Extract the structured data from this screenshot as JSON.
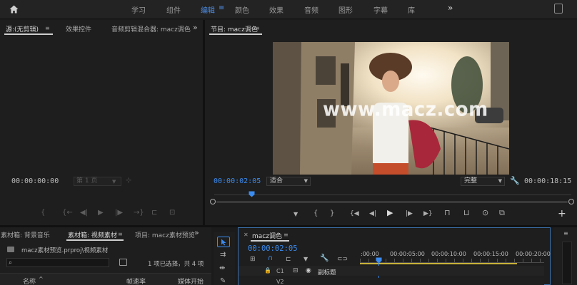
{
  "workspaces": {
    "home_icon": "home-icon",
    "tabs": [
      "学习",
      "组件",
      "编辑",
      "颜色",
      "效果",
      "音频",
      "图形",
      "字幕",
      "库"
    ],
    "active": "编辑",
    "more": "»"
  },
  "source_panel": {
    "tabs": [
      "源:(无剪辑)",
      "效果控件",
      "音频剪辑混合器: macz调色"
    ],
    "more": "»",
    "timecode": "00:00:00:00",
    "page_field": "第 1 页"
  },
  "program_panel": {
    "title": "节目: macz调色",
    "menu": "≡",
    "timecode": "00:00:02:05",
    "fit_label": "适合",
    "quality_label": "完整",
    "duration": "00:00:18:15",
    "watermark": "www.macz.com"
  },
  "project_panel": {
    "tabs": [
      "素材箱: 背景音乐",
      "素材箱: 视频素材",
      "项目: macz素材预览"
    ],
    "more": "»",
    "path": "macz素材预览.prproj\\视频素材",
    "selection_info": "1 项已选择，共 4 项",
    "columns": [
      "名称",
      "帧速率",
      "媒体开始"
    ]
  },
  "timeline_panel": {
    "title": "macz调色",
    "timecode": "00:00:02:05",
    "ruler": [
      ":00:00",
      "00:00:05:00",
      "00:00:10:00",
      "00:00:15:00",
      "00:00:20:00"
    ],
    "tracks": [
      {
        "lock": "🔒",
        "name": "C1",
        "label": "副标题"
      },
      {
        "lock": "",
        "name": "V2",
        "label": ""
      }
    ]
  }
}
